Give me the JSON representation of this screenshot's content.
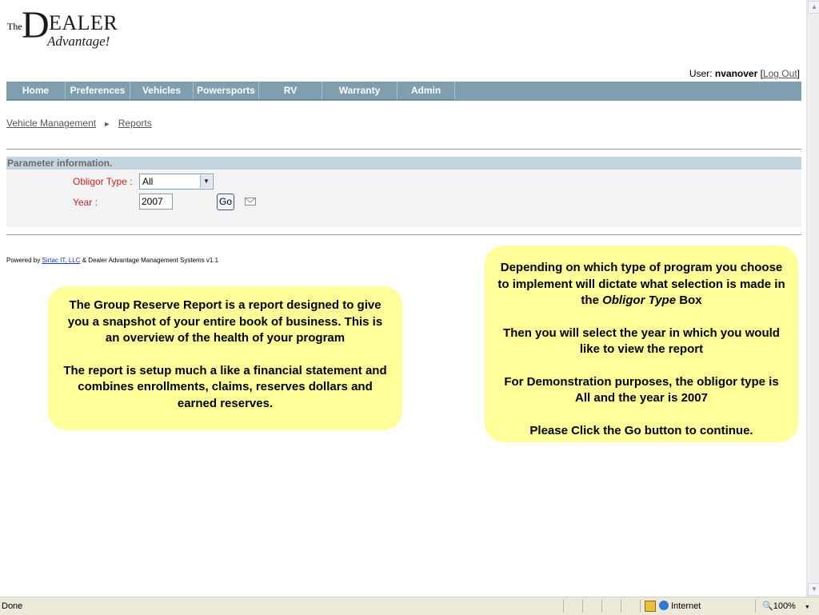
{
  "logo": {
    "the": "The",
    "d": "D",
    "ealer": "EALER",
    "advantage": "Advantage!"
  },
  "user": {
    "prefix": "User:",
    "name": "nvanover",
    "bracket_open": "[",
    "logout_label": "Log Out",
    "bracket_close": "]"
  },
  "nav": {
    "items": [
      {
        "label": "Home"
      },
      {
        "label": "Preferences"
      },
      {
        "label": "Vehicles"
      },
      {
        "label": "Powersports"
      },
      {
        "label": "RV"
      },
      {
        "label": "Warranty Claims"
      },
      {
        "label": "Admin"
      }
    ]
  },
  "breadcrumb": {
    "items": [
      "Vehicle Management",
      "Reports"
    ],
    "separator": "►"
  },
  "params": {
    "title": "Parameter information.",
    "obligor_label": "Obligor Type :",
    "obligor_value": "All",
    "year_label": "Year :",
    "year_value": "2007",
    "go_label": "Go"
  },
  "footer": {
    "prefix": "Powered by",
    "link": "Sirtac IT, LLC",
    "suffix": "& Dealer Advantage Management Systems v1.1"
  },
  "callout_left": {
    "p1": "The Group Reserve Report is a report designed to give you a snapshot of your entire book of business. This is an overview of the health of your program",
    "p2": "The report is setup much a like a financial statement and combines enrollments, claims, reserves dollars and earned reserves."
  },
  "callout_right": {
    "p1_before": "Depending on which type of program you choose to implement will dictate what selection is made in the",
    "p1_italic": "Obligor Type",
    "p1_after": "Box",
    "p2": "Then you will select the year in which you would like to view the report",
    "p3": "For Demonstration purposes, the obligor type is All and the year is 2007",
    "p4": "Please Click the Go button to continue."
  },
  "statusbar": {
    "status": "Done",
    "zone": "Internet",
    "zoom": "100%",
    "zoom_arrow": "▼"
  },
  "colors": {
    "nav_bg": "#7f9fb1",
    "callout_bg": "#ffff99",
    "label_red": "#d02020",
    "param_head_bg": "#c5d4de"
  },
  "icons": [
    "mail-icon",
    "scroll-up-icon",
    "scroll-down-icon",
    "globe-icon",
    "zoom-icon",
    "security-icon"
  ]
}
